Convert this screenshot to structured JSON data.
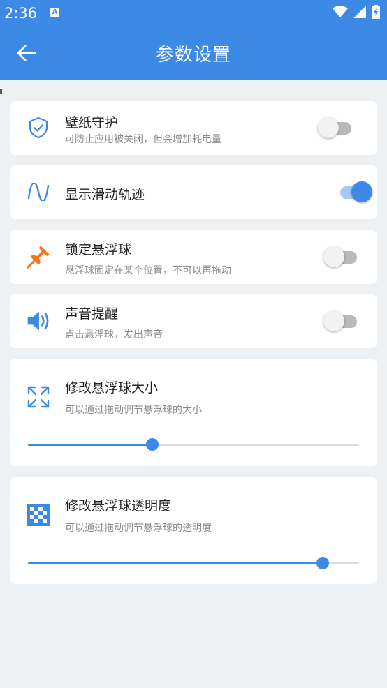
{
  "status_bar": {
    "time": "2:36",
    "notification_icon": "A"
  },
  "header": {
    "title": "参数设置"
  },
  "colors": {
    "accent": "#3d8ae6",
    "pin": "#f5761a",
    "background": "#eef1f4"
  },
  "settings": [
    {
      "key": "wallpaper-guard",
      "icon": "shield-check-icon",
      "title": "壁纸守护",
      "desc": "可防止应用被关闭，但会增加耗电量",
      "enabled": false
    },
    {
      "key": "show-swipe-trail",
      "icon": "sine-wave-icon",
      "title": "显示滑动轨迹",
      "desc": "",
      "enabled": true
    },
    {
      "key": "lock-float-ball",
      "icon": "pin-icon",
      "title": "锁定悬浮球",
      "desc": "悬浮球固定在某个位置，不可以再拖动",
      "enabled": false
    },
    {
      "key": "sound-alert",
      "icon": "speaker-icon",
      "title": "声音提醒",
      "desc": "点击悬浮球，发出声音",
      "enabled": false
    }
  ],
  "sliders": [
    {
      "key": "ball-size",
      "icon": "expand-arrows-icon",
      "title": "修改悬浮球大小",
      "desc": "可以通过拖动调节悬浮球的大小",
      "value": 0.375
    },
    {
      "key": "ball-opacity",
      "icon": "checkerboard-icon",
      "title": "修改悬浮球透明度",
      "desc": "可以通过拖动调节悬浮球的透明度",
      "value": 0.89
    }
  ]
}
